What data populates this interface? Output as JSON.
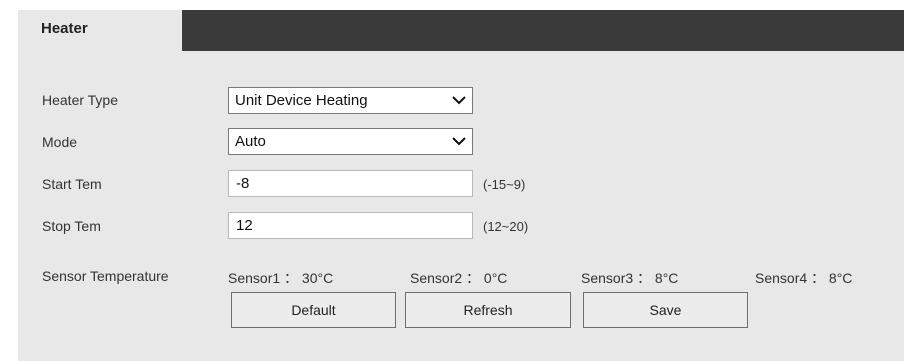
{
  "tabs": [
    {
      "label": "Heater",
      "active": true
    }
  ],
  "fields": {
    "heater_type": {
      "label": "Heater Type",
      "value": "Unit Device Heating"
    },
    "mode": {
      "label": "Mode",
      "value": "Auto"
    },
    "start_tem": {
      "label": "Start Tem",
      "value": "-8",
      "range": "(-15~9)"
    },
    "stop_tem": {
      "label": "Stop Tem",
      "value": "12",
      "range": "(12~20)"
    }
  },
  "sensor_temperature": {
    "label": "Sensor Temperature",
    "sensors": [
      "Sensor1 ： 30°C",
      "Sensor2 ： 0°C",
      "Sensor3 ： 8°C",
      "Sensor4 ： 8°C"
    ]
  },
  "buttons": {
    "default": "Default",
    "refresh": "Refresh",
    "save": "Save"
  },
  "colors": {
    "tabbar": "#3a3a3a",
    "panel": "#e8e8e8"
  }
}
